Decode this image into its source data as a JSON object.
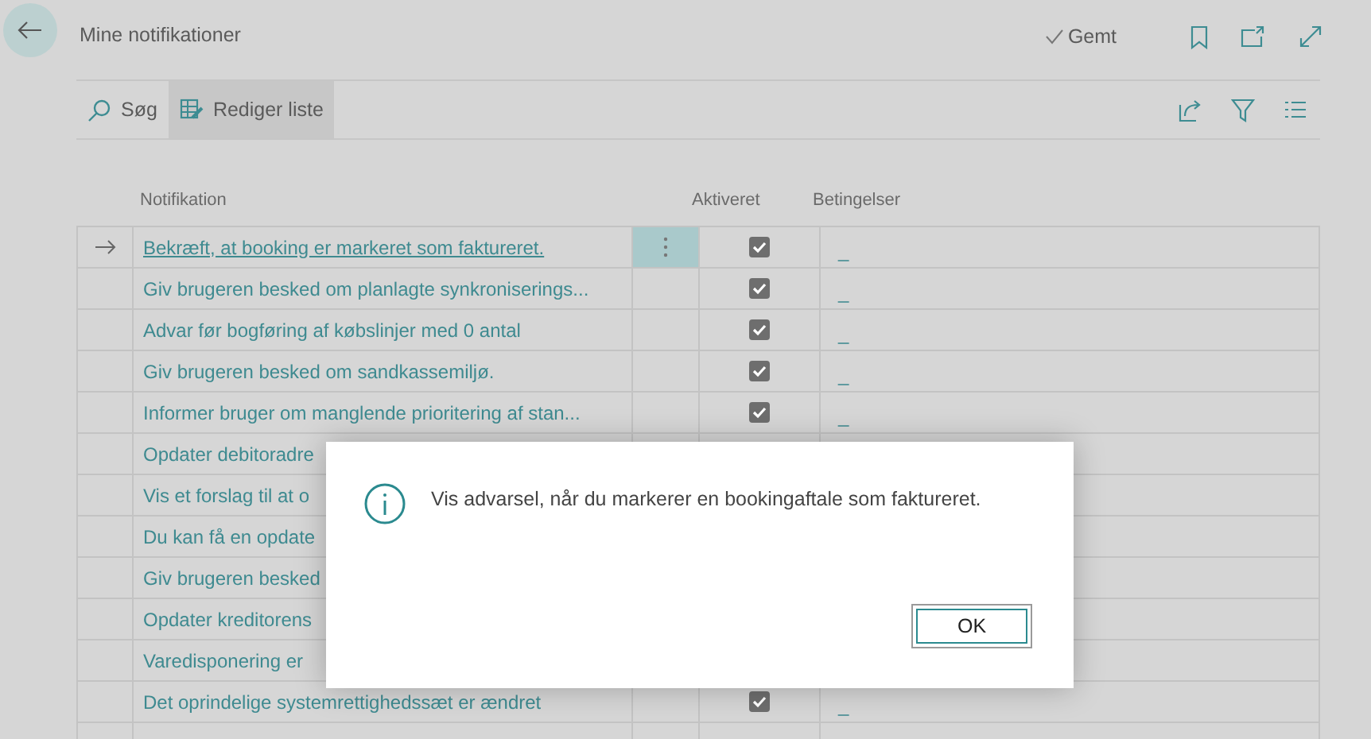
{
  "page": {
    "title": "Mine notifikationer",
    "save_status": "Gemt"
  },
  "toolbar": {
    "actions": [
      {
        "kind": "search",
        "label": "Søg",
        "selected": false
      },
      {
        "kind": "edit",
        "label": "Rediger liste",
        "selected": true
      }
    ]
  },
  "table": {
    "columns": [
      "Notifikation",
      "Aktiveret",
      "Betingelser"
    ],
    "rows": [
      {
        "name": "Bekræft, at booking er markeret som faktureret.",
        "selected": true,
        "enabled": true,
        "conditions": "_"
      },
      {
        "name": "Giv brugeren besked om planlagte synkroniserings...",
        "selected": false,
        "enabled": true,
        "conditions": "_"
      },
      {
        "name": "Advar før bogføring af købslinjer med 0 antal",
        "selected": false,
        "enabled": true,
        "conditions": "_"
      },
      {
        "name": "Giv brugeren besked om sandkassemiljø.",
        "selected": false,
        "enabled": true,
        "conditions": "_"
      },
      {
        "name": "Informer bruger om manglende prioritering af stan...",
        "selected": false,
        "enabled": true,
        "conditions": "_"
      },
      {
        "name": "Opdater debitoradre",
        "selected": false
      },
      {
        "name": "Vis et forslag til at o",
        "selected": false
      },
      {
        "name": "Du kan få en opdate",
        "selected": false
      },
      {
        "name": "Giv brugeren besked",
        "selected": false
      },
      {
        "name": "Opdater kreditorens",
        "selected": false
      },
      {
        "name": "Varedisponering er",
        "selected": false
      },
      {
        "name": "Det oprindelige systemrettighedssæt er ændret",
        "selected": false,
        "enabled": true,
        "conditions": "_"
      },
      {
        "selected": false
      }
    ]
  },
  "dialog": {
    "message": "Vis advarsel, når du markerer en bookingaftale som faktureret.",
    "buttons": [
      "OK"
    ]
  }
}
